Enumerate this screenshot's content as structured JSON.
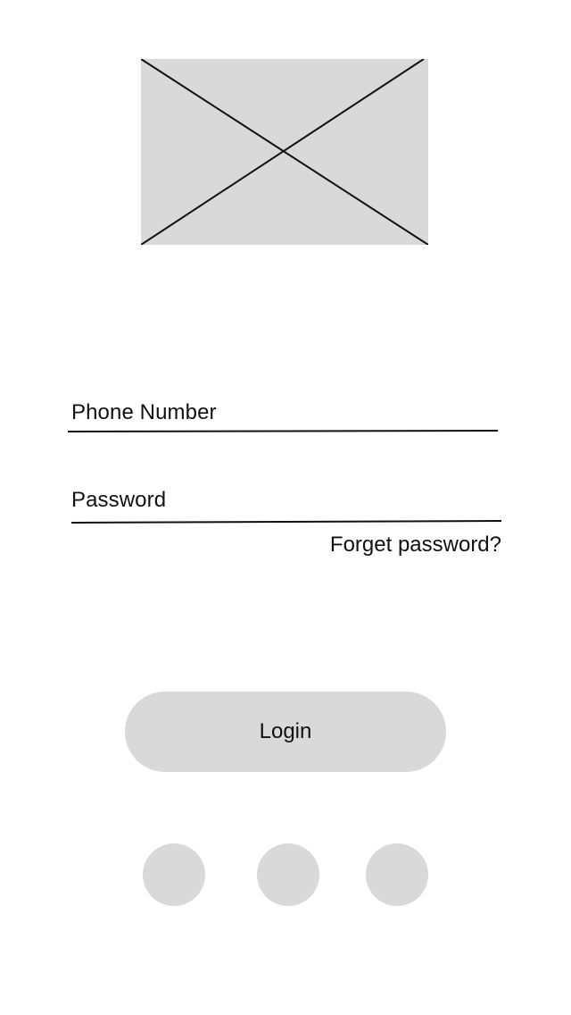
{
  "form": {
    "phone_label": "Phone Number",
    "password_label": "Password",
    "forgot_password": "Forget password?"
  },
  "actions": {
    "login_label": "Login"
  },
  "social_buttons": [
    {
      "icon": "placeholder-circle"
    },
    {
      "icon": "placeholder-circle"
    },
    {
      "icon": "placeholder-circle"
    }
  ],
  "colors": {
    "placeholder_fill": "#d9d9d9",
    "text": "#111111",
    "background": "#ffffff"
  }
}
